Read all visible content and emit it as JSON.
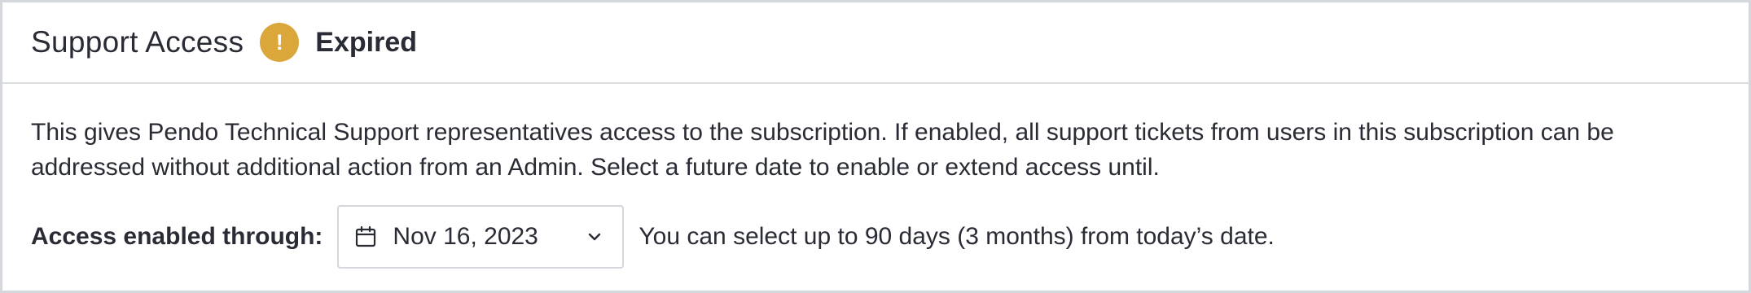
{
  "header": {
    "title": "Support Access",
    "status_icon": "exclamation-circle-icon",
    "status_symbol": "!",
    "status_label": "Expired",
    "status_color": "#dba63a"
  },
  "body": {
    "description": "This gives Pendo Technical Support representatives access to the subscription. If enabled, all support tickets from users in this subscription can be addressed without additional action from an Admin. Select a future date to enable or extend access until.",
    "access_label": "Access enabled through:",
    "date_picker": {
      "icon": "calendar-icon",
      "value": "Nov 16, 2023",
      "chevron": "chevron-down-icon"
    },
    "helper_text": "You can select up to 90 days (3 months) from today’s date."
  }
}
